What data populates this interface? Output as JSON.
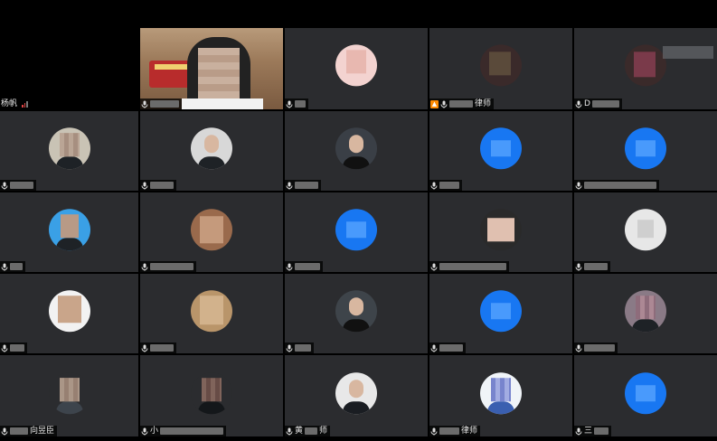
{
  "colors": {
    "tile_background": "#2b2c2f",
    "page_background": "#000000",
    "default_avatar_blue": "#1877f2",
    "host_badge": "#ff8a00",
    "signal_weak": "#e04444"
  },
  "tiles": [
    {
      "label": "杨帆",
      "avatar": "none",
      "signal": true
    },
    {
      "label": "",
      "avatar": "video"
    },
    {
      "label": "",
      "avatar": "pink"
    },
    {
      "label": "律师",
      "avatar": "darkred",
      "host": true
    },
    {
      "label": "D",
      "avatar": "darkred",
      "watermark": true
    },
    {
      "label": "",
      "avatar": "photo"
    },
    {
      "label": "",
      "avatar": "photo"
    },
    {
      "label": "",
      "avatar": "photo"
    },
    {
      "label": "",
      "avatar": "blue"
    },
    {
      "label": "",
      "avatar": "blue"
    },
    {
      "label": "",
      "avatar": "sky"
    },
    {
      "label": "",
      "avatar": "warm"
    },
    {
      "label": "",
      "avatar": "blue"
    },
    {
      "label": "",
      "avatar": "photo"
    },
    {
      "label": "",
      "avatar": "plain"
    },
    {
      "label": "",
      "avatar": "light"
    },
    {
      "label": "",
      "avatar": "tan"
    },
    {
      "label": "",
      "avatar": "photo"
    },
    {
      "label": "",
      "avatar": "blue"
    },
    {
      "label": "",
      "avatar": "photo"
    },
    {
      "label": "向昱臣",
      "avatar": "photo"
    },
    {
      "label": "小",
      "avatar": "photo"
    },
    {
      "label": "黄",
      "avatar": "photo"
    },
    {
      "label": "律师",
      "avatar": "photo"
    },
    {
      "label": "",
      "avatar": "blue"
    }
  ]
}
